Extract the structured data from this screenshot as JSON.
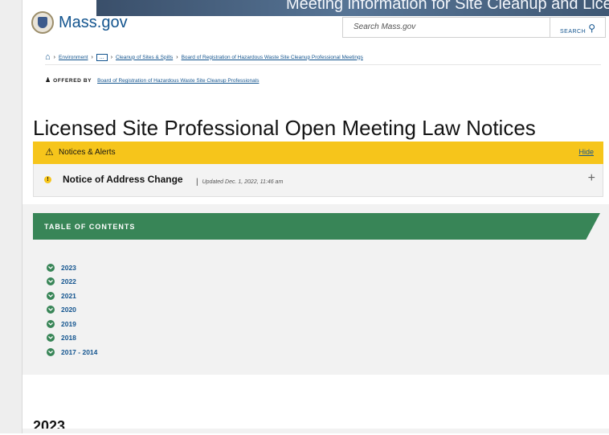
{
  "hero": {
    "text": "Meeting information for Site Cleanup and Licensed Site"
  },
  "header": {
    "logo_text": "Mass.gov",
    "search_placeholder": "Search Mass.gov",
    "search_button": "SEARCH"
  },
  "breadcrumb": {
    "items": [
      "Environment",
      "...",
      "Cleanup of Sites & Spills",
      "Board of Registration of Hazardous Waste Site Cleanup Professional Meetings"
    ]
  },
  "offered_by": {
    "label": "OFFERED BY",
    "org": "Board of Registration of Hazardous Waste Site Cleanup Professionals"
  },
  "page_title": "Licensed Site Professional Open Meeting Law Notices",
  "alerts": {
    "heading": "Notices & Alerts",
    "hide_label": "Hide",
    "items": [
      {
        "title": "Notice of Address Change",
        "updated": "Updated Dec. 1, 2022, 11:46 am"
      }
    ]
  },
  "toc": {
    "heading": "TABLE OF CONTENTS",
    "items": [
      "2023",
      "2022",
      "2021",
      "2020",
      "2019",
      "2018",
      "2017 - 2014"
    ]
  },
  "section": {
    "title": "2023"
  },
  "colors": {
    "brand_blue": "#14558f",
    "alert_yellow": "#f6c51b",
    "toc_green": "#388557"
  }
}
